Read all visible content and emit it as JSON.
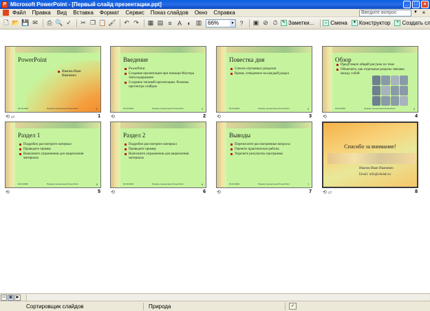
{
  "window": {
    "title": "Microsoft PowerPoint - [Первый слайд презентации.ppt]"
  },
  "menu": {
    "items": [
      "Файл",
      "Правка",
      "Вид",
      "Вставка",
      "Формат",
      "Сервис",
      "Показ слайдов",
      "Окно",
      "Справка"
    ],
    "help_placeholder": "Введите вопрос"
  },
  "toolbar": {
    "zoom": "66%",
    "notes_label": "Заметки...",
    "change_label": "Смена",
    "designer_label": "Конструктор",
    "new_slide_label": "Создать слайд"
  },
  "footer_left": "00.00.0000",
  "footer_center": "Пример презентации PowerPoint",
  "slides": [
    {
      "number": "1",
      "title": "PowerPoint",
      "author": [
        "Иванов Иван",
        "Иванович"
      ],
      "page": "1"
    },
    {
      "number": "2",
      "title": "Введение",
      "bullets": [
        "PowerPoint",
        "Создание презентации при помощи Мастера Автосодержания",
        "Создание типовой презентации. Режимы просмотра слайдов"
      ],
      "page": "2"
    },
    {
      "number": "3",
      "title": "Повестка дня",
      "bullets": [
        "Список изучаемых разделов",
        "Время, отведенное на каждый раздел"
      ],
      "page": "3"
    },
    {
      "number": "4",
      "title": "Обзор",
      "bullets": [
        "Представьте общий рисунок по теме",
        "Объясните, как отдельные разделы связаны между собой"
      ],
      "page": "4"
    },
    {
      "number": "5",
      "title": "Раздел 1",
      "bullets": [
        "Подробно рассмотрите материал",
        "Приведите пример",
        "Выполните упражнения для закрепления материала"
      ],
      "page": "5"
    },
    {
      "number": "6",
      "title": "Раздел 2",
      "bullets": [
        "Подробно рассмотрите материал",
        "Приведите пример",
        "Выполните упражнения для закрепления материала"
      ],
      "page": "6"
    },
    {
      "number": "7",
      "title": "Выводы",
      "bullets": [
        "Перечислите рассмотренные вопросы",
        "Оцените практическое работы",
        "Укрепите результаты программы"
      ],
      "page": "7"
    },
    {
      "number": "8",
      "title": "Спасибо за внимание!",
      "line1": "Иванов Иван Иванович",
      "line2": "Email: info@edulab.ru",
      "page": "8"
    }
  ],
  "status": {
    "view": "Сортировщик слайдов",
    "design": "Природа"
  },
  "colors": {
    "title_bar": "#0a5fe0",
    "slide_bg": "#c6f49e",
    "bullet": "#c01818",
    "chrome": "#ece9d8"
  }
}
